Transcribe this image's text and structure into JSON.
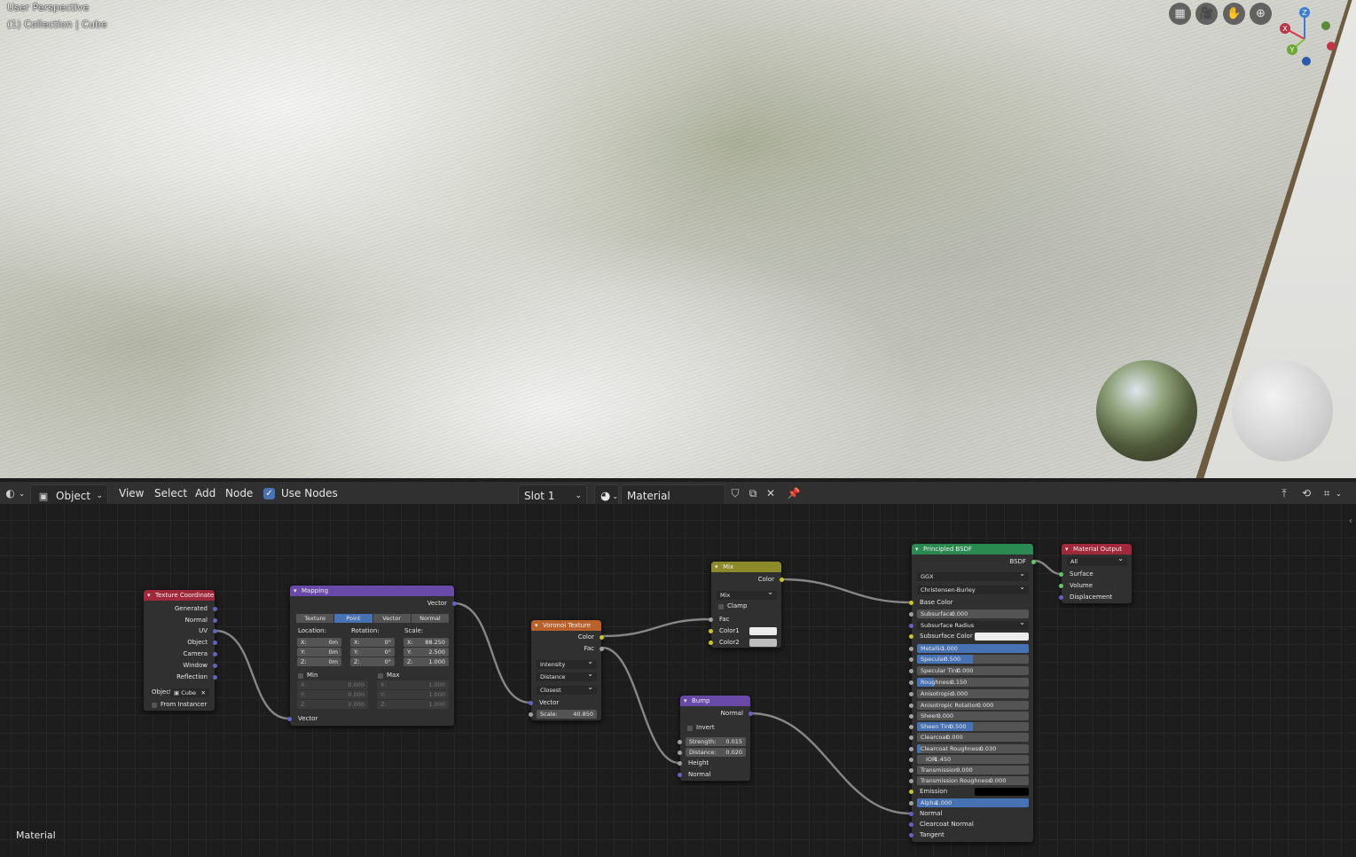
{
  "viewport": {
    "perspective_label": "User Perspective",
    "collection_label": "(1) Collection | Cube",
    "gizmo": {
      "z": "Z",
      "y": "Y",
      "x": "X"
    }
  },
  "header": {
    "editor_icon": "node-editor-icon",
    "mode": "Object",
    "menus": [
      "View",
      "Select",
      "Add",
      "Node"
    ],
    "use_nodes_label": "Use Nodes",
    "slot": "Slot 1",
    "material_name": "Material"
  },
  "editor": {
    "footer_label": "Material"
  },
  "nodes": {
    "texcoord": {
      "title": "Texture Coordinate",
      "outputs": [
        "Generated",
        "Normal",
        "UV",
        "Object",
        "Camera",
        "Window",
        "Reflection"
      ],
      "object_label": "Object",
      "object_value": "Cube",
      "from_instancer": "From Instancer"
    },
    "mapping": {
      "title": "Mapping",
      "output": "Vector",
      "tabs": [
        "Texture",
        "Point",
        "Vector",
        "Normal"
      ],
      "location_label": "Location:",
      "rotation_label": "Rotation:",
      "scale_label": "Scale:",
      "location": [
        {
          "a": "X:",
          "v": "0m"
        },
        {
          "a": "Y:",
          "v": "0m"
        },
        {
          "a": "Z:",
          "v": "0m"
        }
      ],
      "rotation": [
        {
          "a": "X:",
          "v": "0°"
        },
        {
          "a": "Y:",
          "v": "0°"
        },
        {
          "a": "Z:",
          "v": "0°"
        }
      ],
      "scale": [
        {
          "a": "X:",
          "v": "88.250"
        },
        {
          "a": "Y:",
          "v": "2.500"
        },
        {
          "a": "Z:",
          "v": "1.000"
        }
      ],
      "min_label": "Min",
      "max_label": "Max",
      "min": [
        {
          "a": "X:",
          "v": "0.000"
        },
        {
          "a": "Y:",
          "v": "0.000"
        },
        {
          "a": "Z:",
          "v": "0.000"
        }
      ],
      "max": [
        {
          "a": "X:",
          "v": "1.000"
        },
        {
          "a": "Y:",
          "v": "1.000"
        },
        {
          "a": "Z:",
          "v": "1.000"
        }
      ],
      "input": "Vector"
    },
    "voronoi": {
      "title": "Voronoi Texture",
      "outputs": [
        "Color",
        "Fac"
      ],
      "feature": "Intensity",
      "metric": "Distance",
      "coloring": "Closest",
      "input": "Vector",
      "scale_label": "Scale:",
      "scale_value": "40.850"
    },
    "mix": {
      "title": "Mix",
      "output": "Color",
      "blend": "Mix",
      "clamp": "Clamp",
      "inputs": [
        "Fac",
        "Color1",
        "Color2"
      ]
    },
    "bump": {
      "title": "Bump",
      "output": "Normal",
      "invert": "Invert",
      "strength_label": "Strength:",
      "strength_value": "0.015",
      "distance_label": "Distance:",
      "distance_value": "0.020",
      "inputs": [
        "Height",
        "Normal"
      ]
    },
    "bsdf": {
      "title": "Principled BSDF",
      "output": "BSDF",
      "distribution": "GGX",
      "subsurface_method": "Christensen-Burley",
      "base_color": "Base Color",
      "subsurface_radius": "Subsurface Radius",
      "subsurface_color": "Subsurface Color",
      "values": [
        {
          "label": "Subsurface:",
          "value": "0.000",
          "fill": 0.0
        },
        {
          "label": "Metallic:",
          "value": "1.000",
          "fill": 1.0
        },
        {
          "label": "Specular:",
          "value": "0.500",
          "fill": 0.5
        },
        {
          "label": "Specular Tint:",
          "value": "0.000",
          "fill": 0.0
        },
        {
          "label": "Roughness:",
          "value": "0.150",
          "fill": 0.15
        },
        {
          "label": "Anisotropic:",
          "value": "0.000",
          "fill": 0.0
        },
        {
          "label": "Anisotropic Rotation:",
          "value": "0.000",
          "fill": 0.0
        },
        {
          "label": "Sheen:",
          "value": "0.000",
          "fill": 0.0
        },
        {
          "label": "Sheen Tint:",
          "value": "0.500",
          "fill": 0.5
        },
        {
          "label": "Clearcoat:",
          "value": "0.000",
          "fill": 0.0
        },
        {
          "label": "Clearcoat Roughness:",
          "value": "0.030",
          "fill": 0.03
        },
        {
          "label": "IOR:",
          "value": "1.450",
          "fill": 0.0
        },
        {
          "label": "Transmission:",
          "value": "0.000",
          "fill": 0.0
        },
        {
          "label": "Transmission Roughness:",
          "value": "0.000",
          "fill": 0.0
        }
      ],
      "emission": "Emission",
      "alpha_label": "Alpha:",
      "alpha_value": "1.000",
      "tail_inputs": [
        "Normal",
        "Clearcoat Normal",
        "Tangent"
      ]
    },
    "output": {
      "title": "Material Output",
      "target": "All",
      "inputs": [
        "Surface",
        "Volume",
        "Displacement"
      ]
    }
  },
  "colors": {
    "accent": "#4772b3",
    "texcoord_header": "#a1283a",
    "mapping_header": "#6a4aa8",
    "voronoi_header": "#b8612a",
    "mix_header": "#8d8a2a",
    "bump_header": "#6a4aa8",
    "bsdf_header": "#2a8a52",
    "output_header": "#a1283a"
  }
}
